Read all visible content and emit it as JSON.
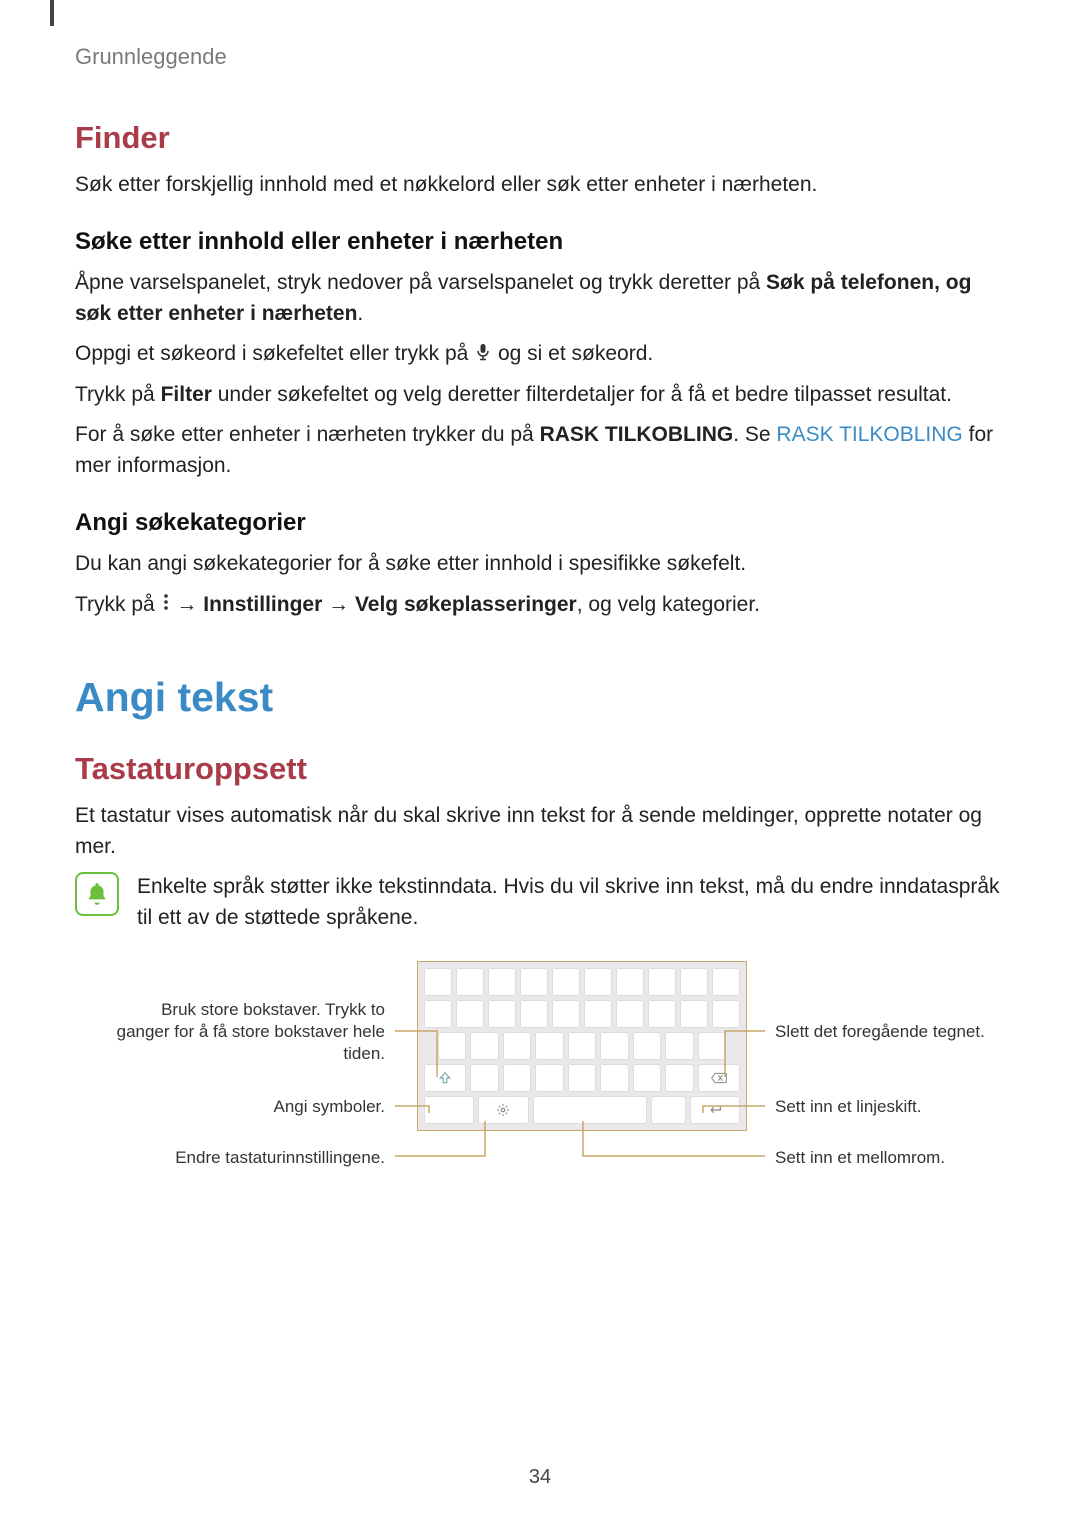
{
  "header": {
    "breadcrumb": "Grunnleggende"
  },
  "section_finder": {
    "title": "Finder",
    "intro": "Søk etter forskjellig innhold med et nøkkelord eller søk etter enheter i nærheten.",
    "sub1_title": "Søke etter innhold eller enheter i nærheten",
    "sub1_p1_a": "Åpne varselspanelet, stryk nedover på varselspanelet og trykk deretter på ",
    "sub1_p1_bold1": "Søk på telefonen, og søk etter enheter i nærheten",
    "sub1_p1_b": ".",
    "sub1_p2_a": "Oppgi et søkeord i søkefeltet eller trykk på ",
    "sub1_p2_b": " og si et søkeord.",
    "sub1_p3_a": "Trykk på ",
    "sub1_p3_bold": "Filter",
    "sub1_p3_b": " under søkefeltet og velg deretter filterdetaljer for å få et bedre tilpasset resultat.",
    "sub1_p4_a": "For å søke etter enheter i nærheten trykker du på ",
    "sub1_p4_bold": "RASK TILKOBLING",
    "sub1_p4_b": ". Se ",
    "sub1_p4_link": "RASK TILKOBLING",
    "sub1_p4_c": " for mer informasjon.",
    "sub2_title": "Angi søkekategorier",
    "sub2_p1": "Du kan angi søkekategorier for å søke etter innhold i spesifikke søkefelt.",
    "sub2_p2_a": "Trykk på ",
    "sub2_p2_b": " → ",
    "sub2_p2_bold1": "Innstillinger",
    "sub2_p2_c": " → ",
    "sub2_p2_bold2": "Velg søkeplasseringer",
    "sub2_p2_d": ", og velg kategorier."
  },
  "section_angi": {
    "title": "Angi tekst",
    "sub1_title": "Tastaturoppsett",
    "sub1_p1": "Et tastatur vises automatisk når du skal skrive inn tekst for å sende meldinger, opprette notater og mer.",
    "note": "Enkelte språk støtter ikke tekstinndata. Hvis du vil skrive inn tekst, må du endre inndataspråk til ett av de støttede språkene.",
    "callouts": {
      "caps": "Bruk store bokstaver. Trykk to ganger for å få store bokstaver hele tiden.",
      "symbols": "Angi symboler.",
      "settings": "Endre tastaturinnstillingene.",
      "delete": "Slett det foregående tegnet.",
      "enter": "Sett inn et linjeskift.",
      "space": "Sett inn et mellomrom."
    }
  },
  "page_number": "34"
}
